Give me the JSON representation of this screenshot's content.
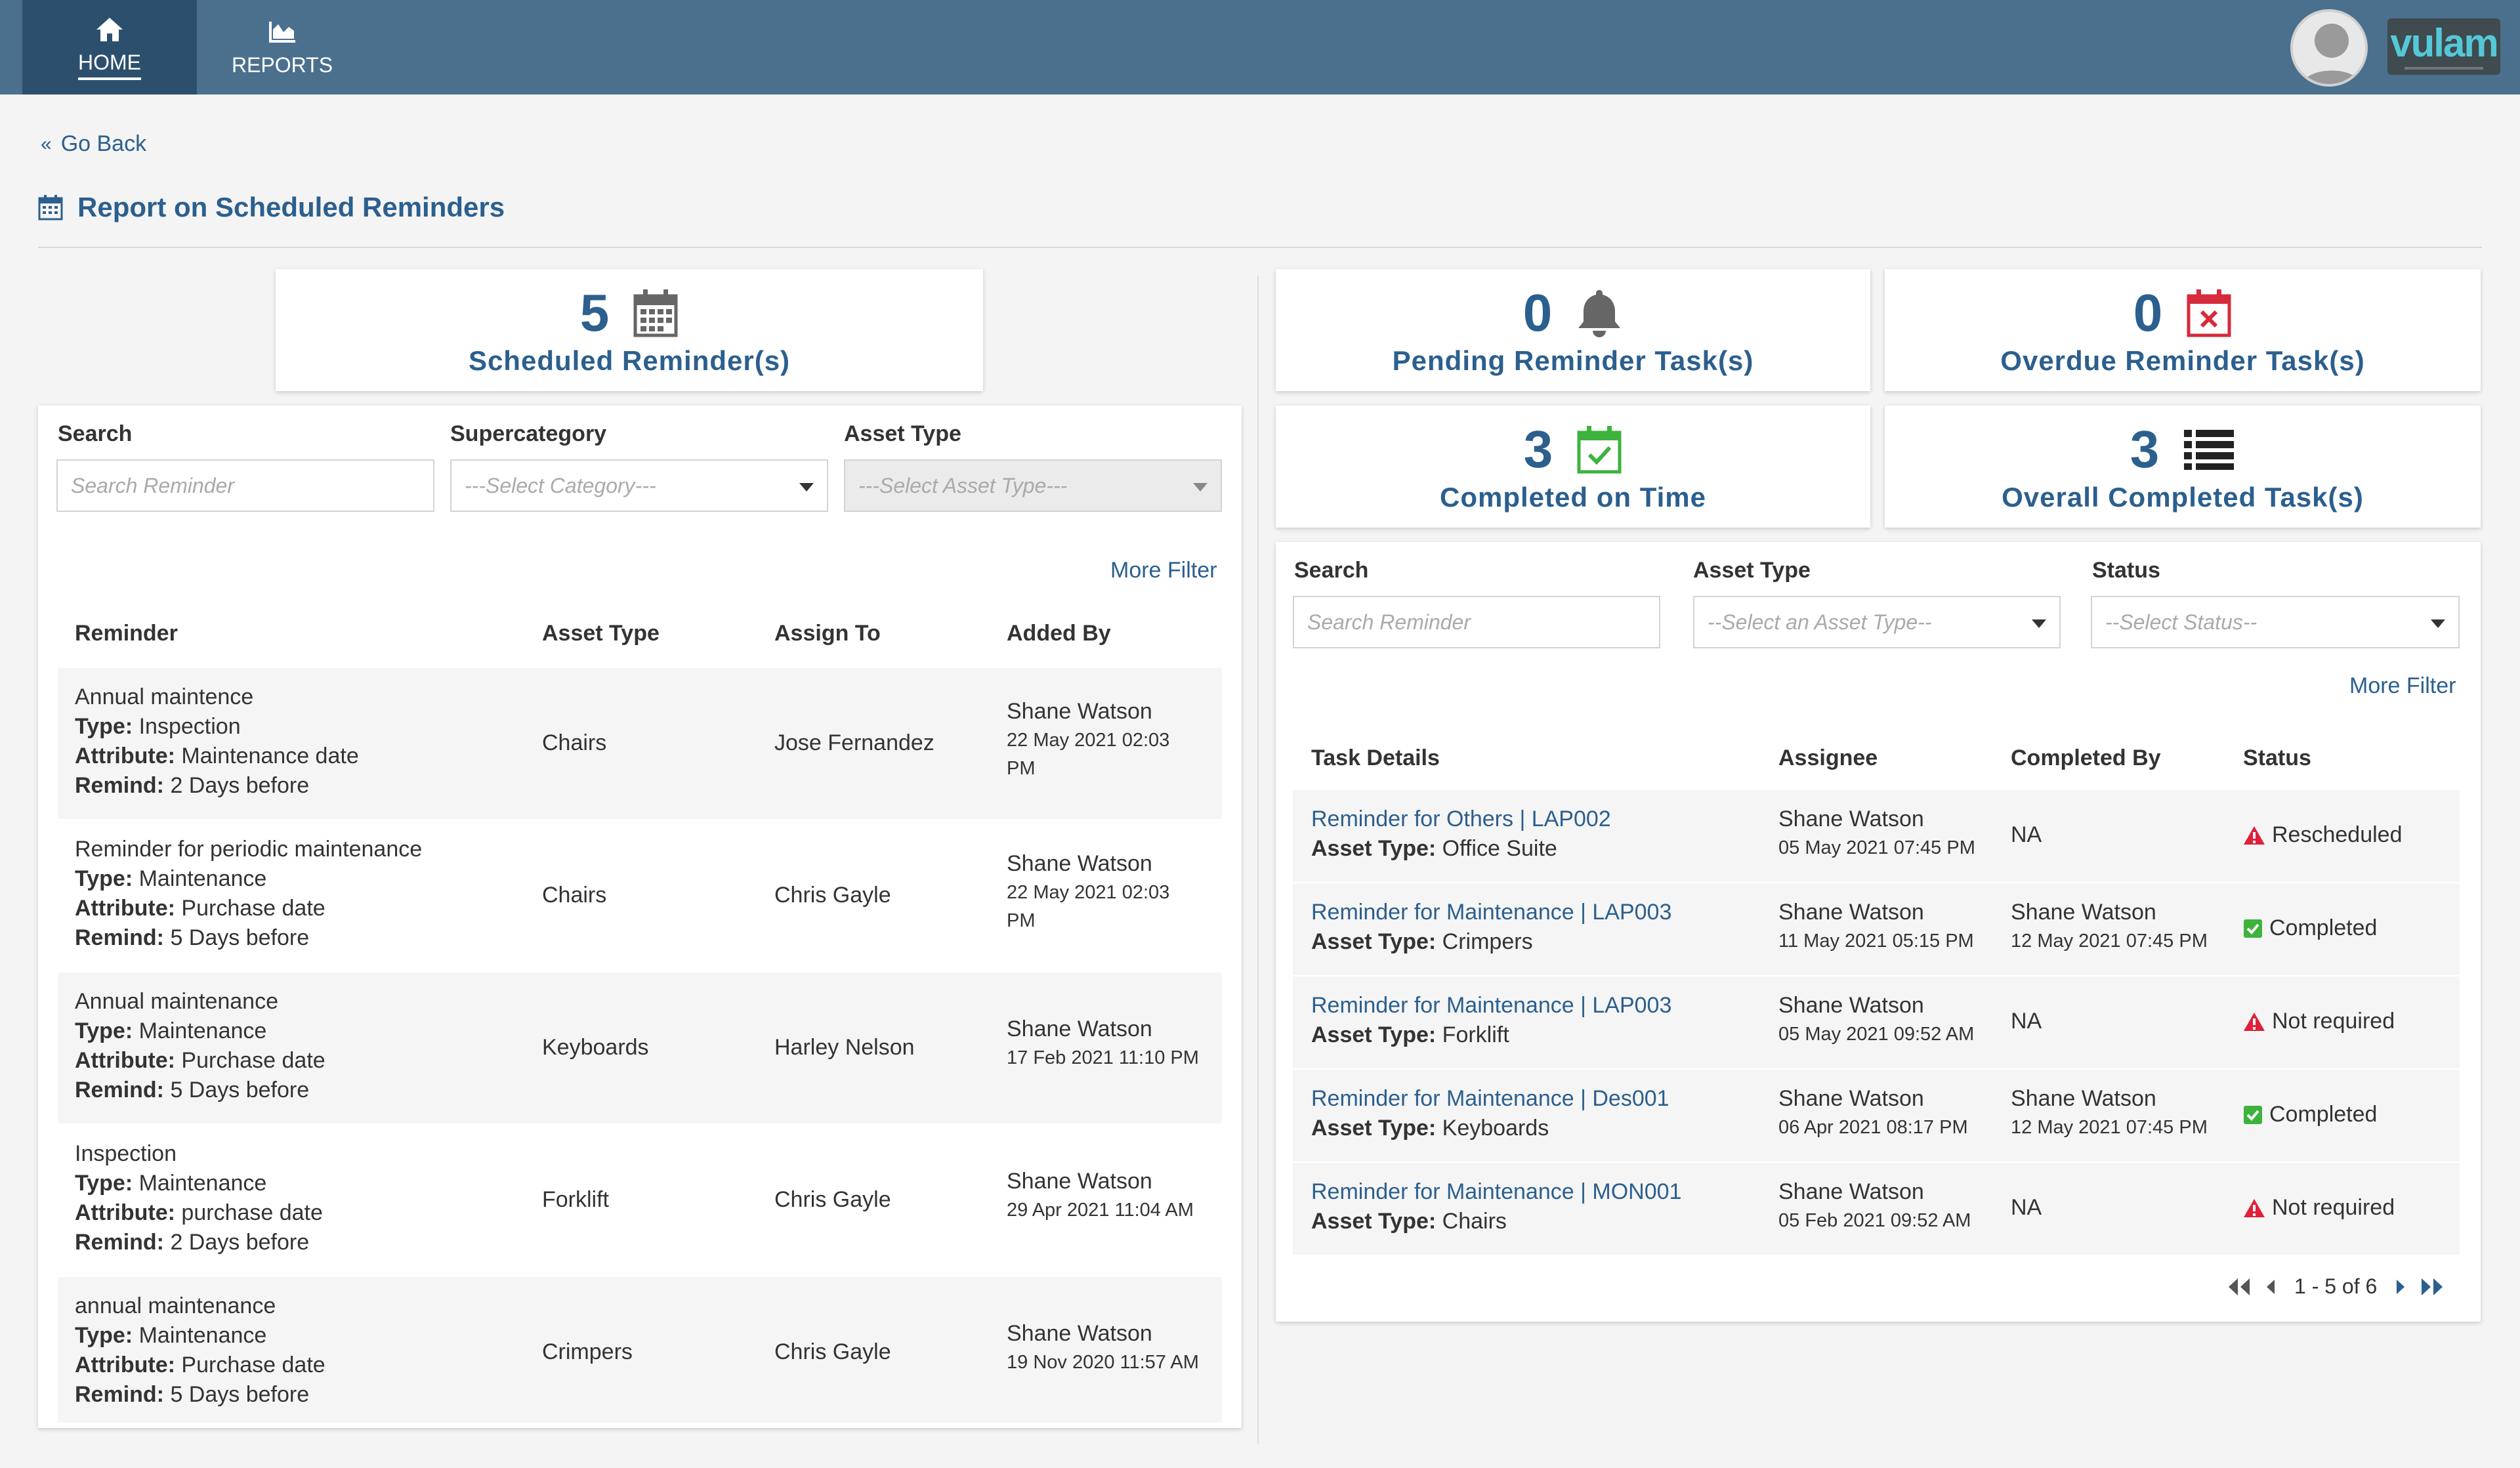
{
  "nav": {
    "home": "HOME",
    "reports": "REPORTS",
    "logo_text": "vulam"
  },
  "page": {
    "go_back": "Go Back",
    "title": "Report on Scheduled Reminders"
  },
  "stats": {
    "scheduled": {
      "count": "5",
      "label": "Scheduled Reminder(s)"
    },
    "pending": {
      "count": "0",
      "label": "Pending Reminder Task(s)"
    },
    "overdue": {
      "count": "0",
      "label": "Overdue Reminder Task(s)"
    },
    "completed_on_time": {
      "count": "3",
      "label": "Completed on Time"
    },
    "overall_completed": {
      "count": "3",
      "label": "Overall Completed Task(s)"
    }
  },
  "colors": {
    "nav_bg": "#4a708e",
    "nav_active": "#2c4f6e",
    "accent": "#2b5f8e",
    "overdue_red": "#d62b3c",
    "completed_green": "#3db33d",
    "warning_red": "#e0203a"
  },
  "left": {
    "filters": {
      "search_label": "Search",
      "search_placeholder": "Search Reminder",
      "supercategory_label": "Supercategory",
      "supercategory_value": "---Select Category---",
      "asset_type_label": "Asset Type",
      "asset_type_value": "---Select Asset Type---",
      "more_filter": "More Filter"
    },
    "columns": [
      "Reminder",
      "Asset Type",
      "Assign To",
      "Added By"
    ],
    "field_labels": {
      "type": "Type:",
      "attribute": "Attribute:",
      "remind": "Remind:"
    },
    "rows": [
      {
        "name": "Annual maintence",
        "type": "Inspection",
        "attribute": "Maintenance date",
        "remind": "2 Days before",
        "asset_type": "Chairs",
        "assign_to": "Jose Fernandez",
        "added_by": "Shane Watson",
        "added_on_1": "22 May 2021 02:03",
        "added_on_2": "PM"
      },
      {
        "name": "Reminder for periodic maintenance",
        "type": "Maintenance",
        "attribute": "Purchase date",
        "remind": "5 Days before",
        "asset_type": "Chairs",
        "assign_to": "Chris Gayle",
        "added_by": "Shane Watson",
        "added_on_1": "22 May 2021 02:03",
        "added_on_2": "PM"
      },
      {
        "name": "Annual maintenance",
        "type": "Maintenance",
        "attribute": "Purchase date",
        "remind": "5 Days before",
        "asset_type": "Keyboards",
        "assign_to": "Harley Nelson",
        "added_by": "Shane Watson",
        "added_on_1": "17 Feb 2021 11:10 PM",
        "added_on_2": ""
      },
      {
        "name": "Inspection",
        "type": "Maintenance",
        "attribute": "purchase date",
        "remind": "2 Days before",
        "asset_type": "Forklift",
        "assign_to": "Chris Gayle",
        "added_by": "Shane Watson",
        "added_on_1": "29 Apr 2021 11:04 AM",
        "added_on_2": ""
      },
      {
        "name": "annual maintenance",
        "type": "Maintenance",
        "attribute": "Purchase date",
        "remind": "5 Days before",
        "asset_type": "Crimpers",
        "assign_to": "Chris Gayle",
        "added_by": "Shane Watson",
        "added_on_1": "19 Nov 2020 11:57 AM",
        "added_on_2": ""
      }
    ]
  },
  "right": {
    "filters": {
      "search_label": "Search",
      "search_placeholder": "Search Reminder",
      "asset_type_label": "Asset Type",
      "asset_type_value": "--Select an Asset Type--",
      "status_label": "Status",
      "status_value": "--Select Status--",
      "more_filter": "More Filter"
    },
    "columns": [
      "Task Details",
      "Assignee",
      "Completed By",
      "Status"
    ],
    "asset_type_label": "Asset Type:",
    "tasks": [
      {
        "title": "Reminder for Others  |  LAP002",
        "asset_type": "Office Suite",
        "assignee": "Shane Watson",
        "assigned_on": "05 May 2021 07:45 PM",
        "completed_by": "NA",
        "completed_on": "",
        "status": "Rescheduled",
        "status_icon": "warning-icon"
      },
      {
        "title": "Reminder for Maintenance  |  LAP003",
        "asset_type": "Crimpers",
        "assignee": "Shane Watson",
        "assigned_on": "11 May 2021 05:15 PM",
        "completed_by": "Shane Watson",
        "completed_on": "12 May 2021 07:45 PM",
        "status": "Completed",
        "status_icon": "check-icon"
      },
      {
        "title": "Reminder for Maintenance  |  LAP003",
        "asset_type": "Forklift",
        "assignee": "Shane Watson",
        "assigned_on": "05 May 2021 09:52 AM",
        "completed_by": "NA",
        "completed_on": "",
        "status": "Not required",
        "status_icon": "warning-icon"
      },
      {
        "title": "Reminder for Maintenance  |  Des001",
        "asset_type": "Keyboards",
        "assignee": "Shane Watson",
        "assigned_on": "06 Apr 2021 08:17 PM",
        "completed_by": "Shane Watson",
        "completed_on": "12 May 2021 07:45 PM",
        "status": "Completed",
        "status_icon": "check-icon"
      },
      {
        "title": "Reminder for Maintenance  |  MON001",
        "asset_type": "Chairs",
        "assignee": "Shane Watson",
        "assigned_on": "05 Feb 2021 09:52 AM",
        "completed_by": "NA",
        "completed_on": "",
        "status": "Not required",
        "status_icon": "warning-icon"
      }
    ],
    "pagination": {
      "range": "1 - 5 of 6"
    }
  }
}
